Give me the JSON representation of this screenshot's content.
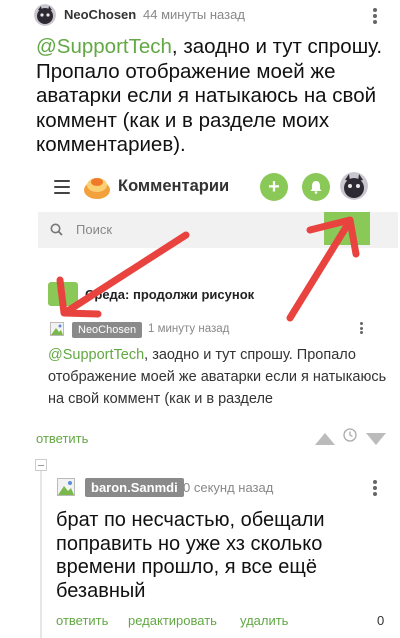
{
  "comment": {
    "author": "NeoChosen",
    "time": "44 минуты назад",
    "mention": "@SupportTech",
    "text": ", заодно и тут спрошу. Пропало отображение моей же аватарки если я натыкаюсь на свой коммент (как и в разделе моих комментариев)."
  },
  "embedded": {
    "header_title": "Комментарии",
    "search_placeholder": "Поиск",
    "post_title": "Среда: продолжи рисунок",
    "author": "NeoChosen",
    "time": "1 минуту назад",
    "mention": "@SupportTech",
    "text": ", заодно и тут спрошу. Пропало отображение моей же аватарки если я натыкаюсь на свой коммент (как и в разделе",
    "arrow_color": "#e8433f"
  },
  "comment_actions": {
    "reply": "ответить"
  },
  "reply": {
    "author": "baron.Sanmdi",
    "time": "0 секунд назад",
    "text": "брат по несчастью, обещали поправить но уже хз сколько времени прошло, я все ещё безавный",
    "actions": {
      "reply": "ответить",
      "edit": "редактировать",
      "delete": "удалить"
    },
    "rating": "0"
  },
  "colors": {
    "accent": "#62a844",
    "button_green": "#8ac858",
    "badge_grey": "#8a8a8a"
  }
}
